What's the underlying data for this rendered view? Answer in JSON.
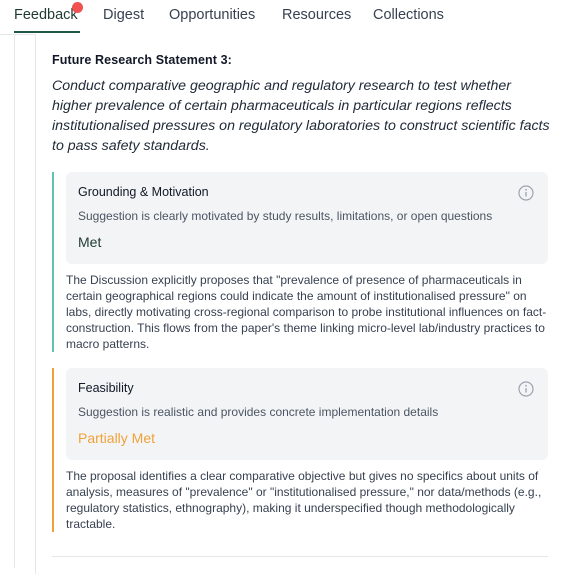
{
  "tabs": [
    {
      "label": "Feedback",
      "active": true
    },
    {
      "label": "Digest"
    },
    {
      "label": "Opportunities"
    },
    {
      "label": "Resources"
    },
    {
      "label": "Collections"
    }
  ],
  "statement": {
    "title": "Future Research Statement 3:",
    "text": "Conduct comparative geographic and regulatory research to test whether higher prevalence of certain pharmaceuticals in particular regions reflects institutionalised pressures on regulatory laboratories to construct scientific facts to pass safety standards."
  },
  "criteria": [
    {
      "title": "Grounding & Motivation",
      "description": "Suggestion is clearly motivated by study results, limitations, or open questions",
      "status": "Met",
      "status_color": "#1f3a33",
      "bar_color": "#5ec4b0",
      "explanation": "The Discussion explicitly proposes that \"prevalence of presence of pharmaceuticals in certain geographical regions could indicate the amount of institutionalised pressure\" on labs, directly motivating cross-regional comparison to probe institutional influences on fact-construction. This flows from the paper's theme linking micro-level lab/industry practices to macro patterns."
    },
    {
      "title": "Feasibility",
      "description": "Suggestion is realistic and provides concrete implementation details",
      "status": "Partially Met",
      "status_color": "#f0a23a",
      "bar_color": "#f0a23a",
      "explanation": "The proposal identifies a clear comparative objective but gives no specifics about units of analysis, measures of \"prevalence\" or \"institutionalised pressure,\" nor data/methods (e.g., regulatory statistics, ethnography), making it underspecified though methodologically tractable."
    }
  ],
  "icons": {
    "info": "info-icon",
    "notification": "notification-dot"
  },
  "colors": {
    "accent": "#1e5546",
    "notification": "#f05252"
  }
}
